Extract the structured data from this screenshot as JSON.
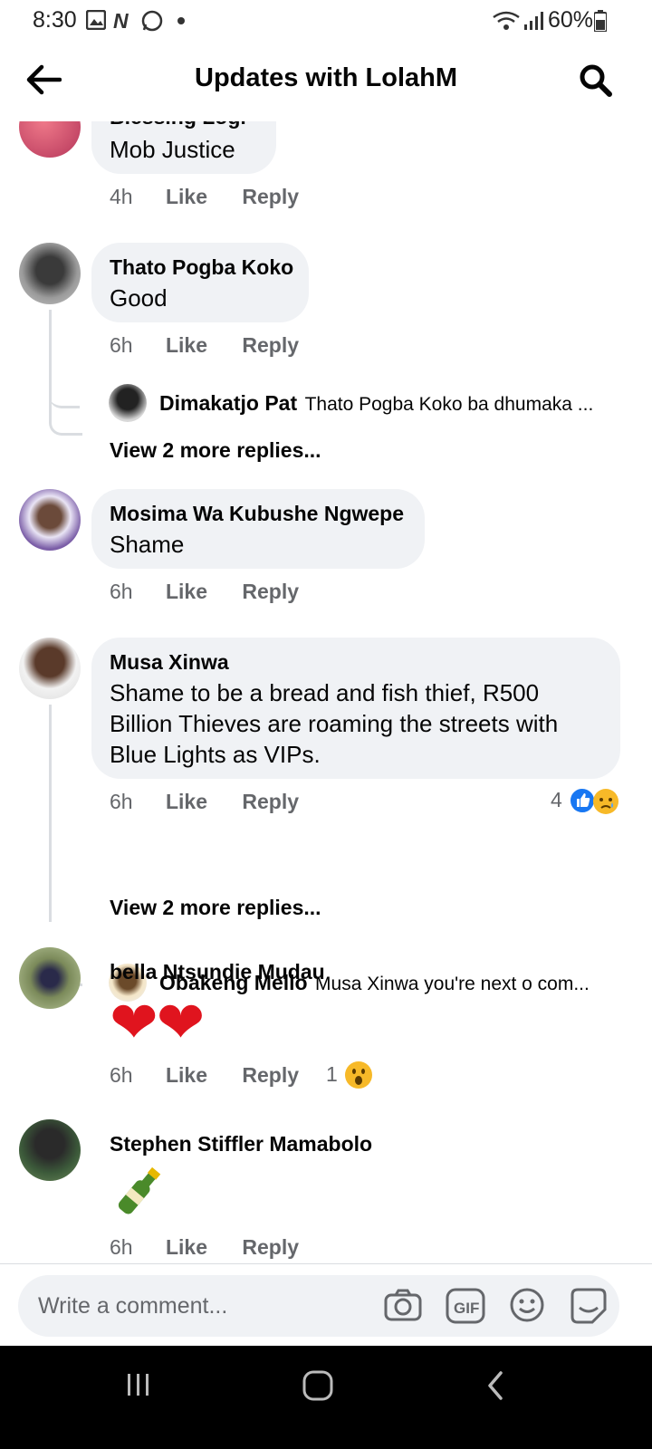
{
  "status_bar": {
    "time": "8:30",
    "battery": "60%"
  },
  "header": {
    "title": "Updates with LolahM"
  },
  "comments": [
    {
      "name": "Blessing Logi",
      "text": "Mob Justice",
      "time": "4h",
      "like": "Like",
      "reply": "Reply"
    },
    {
      "name": "Thato Pogba Koko",
      "text": "Good",
      "time": "6h",
      "like": "Like",
      "reply": "Reply",
      "reply_preview": {
        "name": "Dimakatjo Pat",
        "text": "Thato Pogba Koko ba dhumaka ..."
      },
      "more_replies": "View 2 more replies..."
    },
    {
      "name": "Mosima Wa Kubushe Ngwepe",
      "text": "Shame",
      "time": "6h",
      "like": "Like",
      "reply": "Reply"
    },
    {
      "name": "Musa Xinwa",
      "text_lines": [
        "Shame to be a bread and fish thief, R500",
        "Billion Thieves are roaming the streets with",
        "Blue Lights as VIPs."
      ],
      "time": "6h",
      "like": "Like",
      "reply": "Reply",
      "reaction_count": "4",
      "reply_preview": {
        "name": "Obakeng Mello",
        "text": "Musa Xinwa you're next o com..."
      },
      "more_replies": "View 2 more replies..."
    },
    {
      "name": "bella Ntsundie Mudau",
      "text": "❤❤",
      "time": "6h",
      "like": "Like",
      "reply": "Reply",
      "reaction_count": "1"
    },
    {
      "name": "Stephen Stiffler Mamabolo",
      "text": "🍾",
      "time": "6h",
      "like": "Like",
      "reply": "Reply"
    }
  ],
  "composer": {
    "placeholder": "Write a comment..."
  },
  "colors": {
    "bubble": "#f0f2f5",
    "meta": "#65676b",
    "like_blue": "#1877f2",
    "emoji_yellow": "#f7b928"
  }
}
